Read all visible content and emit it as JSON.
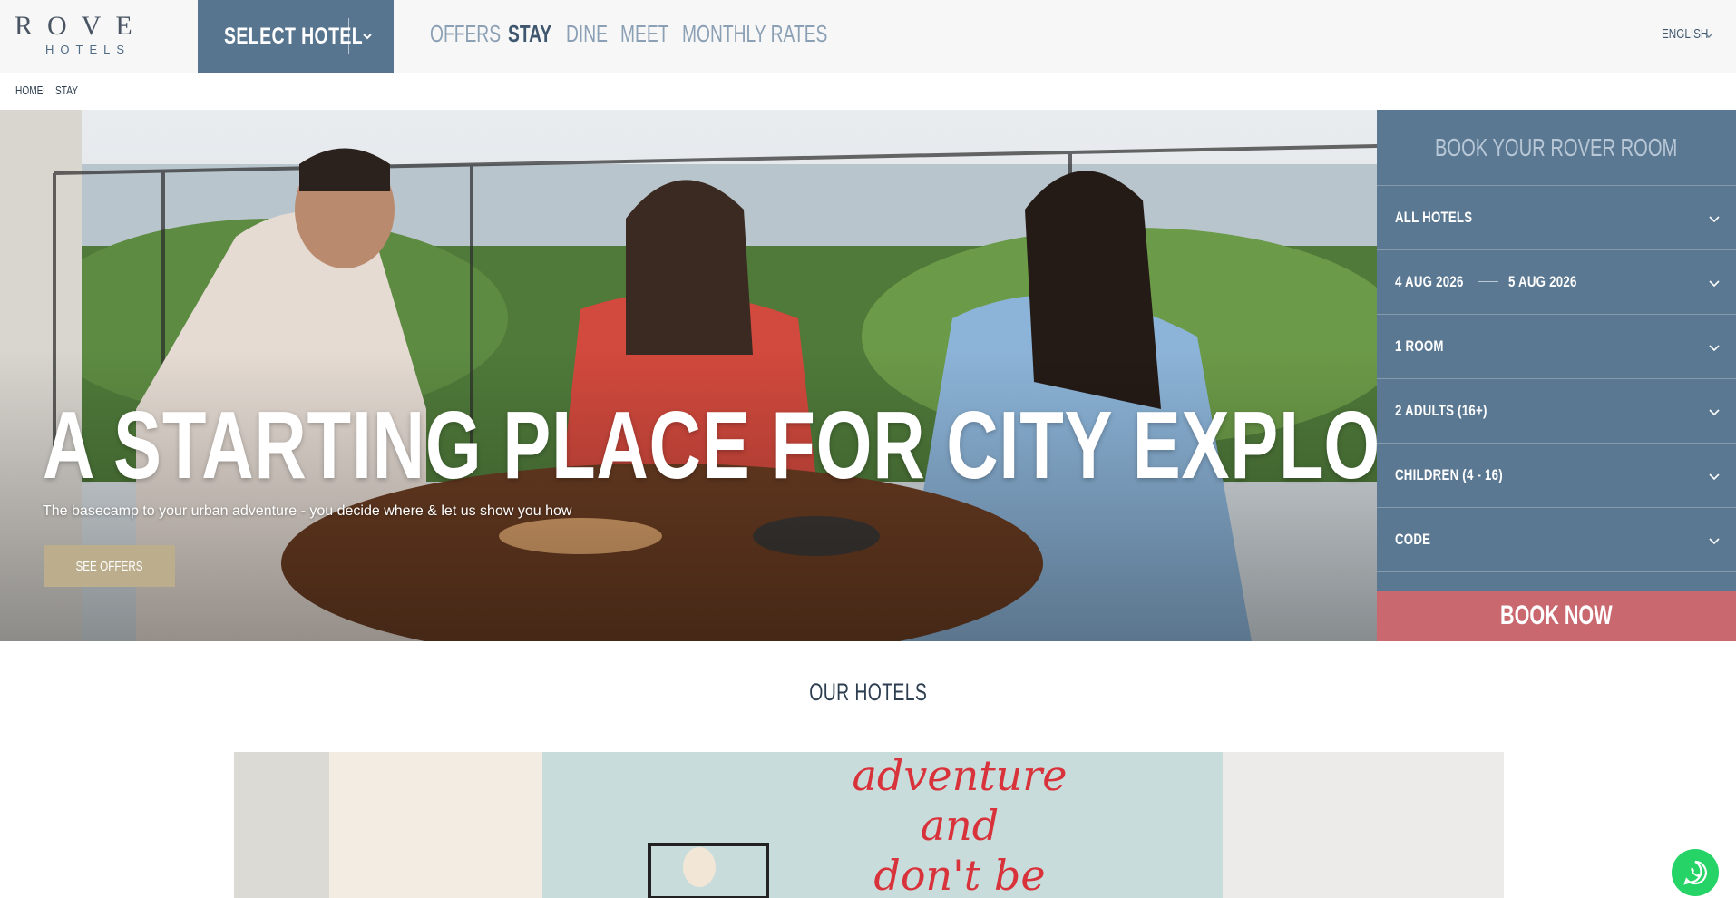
{
  "header": {
    "logo_main": "ROVE",
    "logo_sub": "HOTELS",
    "select_hotel_label": "SELECT HOTEL",
    "nav": [
      {
        "label": "OFFERS",
        "active": false
      },
      {
        "label": "STAY",
        "active": true
      },
      {
        "label": "DINE",
        "active": false
      },
      {
        "label": "MEET",
        "active": false
      },
      {
        "label": "MONTHLY RATES",
        "active": false
      }
    ],
    "language": "ENGLISH"
  },
  "breadcrumb": {
    "home": "HOME",
    "current": "STAY"
  },
  "hero": {
    "title": "A STARTING PLACE FOR CITY EXPLORERS",
    "subtitle": "The basecamp to your urban adventure - you decide where & let us show you how",
    "cta_label": "SEE OFFERS"
  },
  "booking": {
    "title": "BOOK YOUR ROVER ROOM",
    "hotel": "ALL HOTELS",
    "check_in": "4 AUG 2026",
    "check_out": "5 AUG 2026",
    "rooms": "1 ROOM",
    "adults": "2 ADULTS (16+)",
    "children": "CHILDREN (4 - 16)",
    "code": "CODE",
    "book_now_label": "BOOK NOW"
  },
  "hotels_section": {
    "title": "OUR HOTELS",
    "image_text_lines": [
      "adventure",
      "and",
      "don't be"
    ]
  },
  "colors": {
    "brand_blue": "#587590",
    "booking_panel": "#5b7892",
    "book_now": "#c9686e",
    "cta_tan": "#bcae8d",
    "nav_inactive": "#8ba0b5",
    "nav_active": "#3e566e",
    "whatsapp": "#25d366"
  },
  "icons": {
    "select_hotel": "chevron-down-icon",
    "language": "chevron-down-icon",
    "booking_fields": "chevron-down-icon",
    "chat": "whatsapp-icon"
  }
}
